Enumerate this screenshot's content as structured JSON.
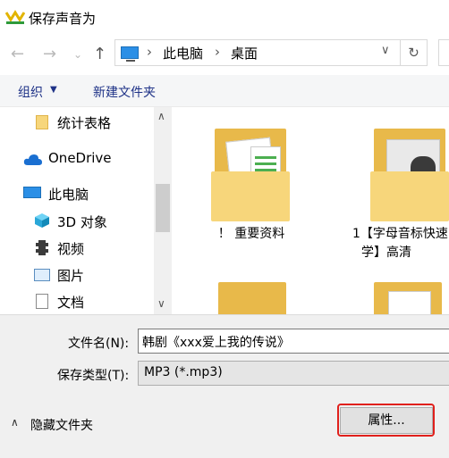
{
  "window": {
    "title": "保存声音为"
  },
  "address": {
    "crumbs": [
      "此电脑",
      "桌面"
    ]
  },
  "toolbar": {
    "organize": "组织",
    "new_folder": "新建文件夹"
  },
  "nav": {
    "items": [
      {
        "label": "统计表格",
        "icon": "folder-icon"
      },
      {
        "label": "OneDrive",
        "icon": "cloud-icon"
      },
      {
        "label": "此电脑",
        "icon": "computer-icon"
      },
      {
        "label": "3D 对象",
        "icon": "cube-icon"
      },
      {
        "label": "视频",
        "icon": "film-icon"
      },
      {
        "label": "图片",
        "icon": "picture-icon"
      },
      {
        "label": "文档",
        "icon": "document-icon"
      }
    ]
  },
  "content": {
    "items": [
      {
        "label": "！ 重要资料"
      },
      {
        "label_line1": "1【字母音标快速",
        "label_line2": "学】高清"
      },
      {
        "label": ""
      },
      {
        "label": ""
      }
    ]
  },
  "form": {
    "filename_label": "文件名(N):",
    "filename_value": "韩剧《xxx爱上我的传说》",
    "type_label": "保存类型(T):",
    "type_value": "MP3 (*.mp3)"
  },
  "footer": {
    "hide_folders": "隐藏文件夹",
    "properties": "属性..."
  },
  "colors": {
    "highlight": "#e0201c",
    "accent": "#1e3287"
  }
}
